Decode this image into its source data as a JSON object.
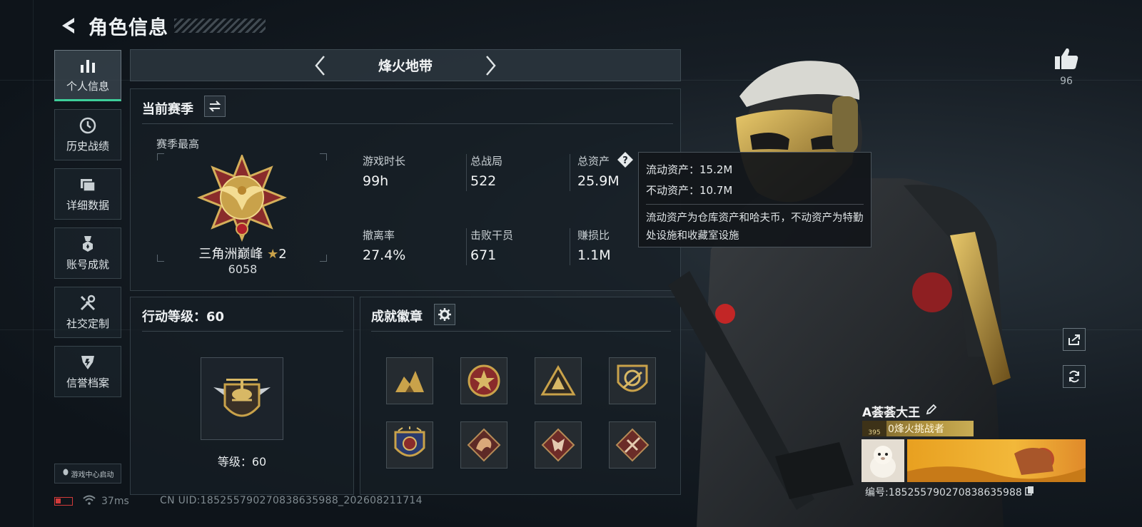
{
  "header": {
    "title": "角色信息"
  },
  "nav": {
    "items": [
      {
        "label": "个人信息",
        "icon": "bar-chart-icon",
        "active": true
      },
      {
        "label": "历史战绩",
        "icon": "clock-icon"
      },
      {
        "label": "详细数据",
        "icon": "folder-icon"
      },
      {
        "label": "账号成就",
        "icon": "medal-icon"
      },
      {
        "label": "社交定制",
        "icon": "tools-icon"
      },
      {
        "label": "信誉档案",
        "icon": "shield-icon"
      }
    ],
    "game_center": "游戏中心启动"
  },
  "mode": {
    "title": "烽火地带"
  },
  "season": {
    "title": "当前赛季",
    "best_label": "赛季最高",
    "rank_name": "三角洲巅峰",
    "rank_stars": "2",
    "rank_score": "6058",
    "stats": [
      {
        "label": "游戏时长",
        "value": "99h"
      },
      {
        "label": "总战局",
        "value": "522"
      },
      {
        "label": "总资产",
        "value": "25.9M"
      },
      {
        "label": "撤离率",
        "value": "27.4%"
      },
      {
        "label": "击败干员",
        "value": "671"
      },
      {
        "label": "赚损比",
        "value": "1.1M"
      }
    ]
  },
  "tooltip": {
    "liquid": "流动资产：15.2M",
    "fixed": "不动资产：10.7M",
    "description": "流动资产为仓库资产和哈夫币，不动资产为特勤处设施和收藏室设施"
  },
  "action_level": {
    "title": "行动等级：60",
    "level_text": "等级：60"
  },
  "badges": {
    "title": "成就徽章",
    "items": [
      "badge-1",
      "badge-2",
      "badge-3",
      "badge-4",
      "badge-5",
      "badge-6",
      "badge-7",
      "badge-8"
    ]
  },
  "like": {
    "count": "96"
  },
  "player": {
    "name": "A荟荟大王",
    "title_level": "395",
    "title_text": "0烽火挑战者",
    "id": "编号:1852557902708386359​88"
  },
  "status": {
    "ping": "37ms",
    "uid": "CN UID:1852557902708386359​88_202608211714"
  },
  "colors": {
    "accent": "#3ecf9a",
    "gold": "#c9a24a",
    "battery": "#d23a3a"
  }
}
